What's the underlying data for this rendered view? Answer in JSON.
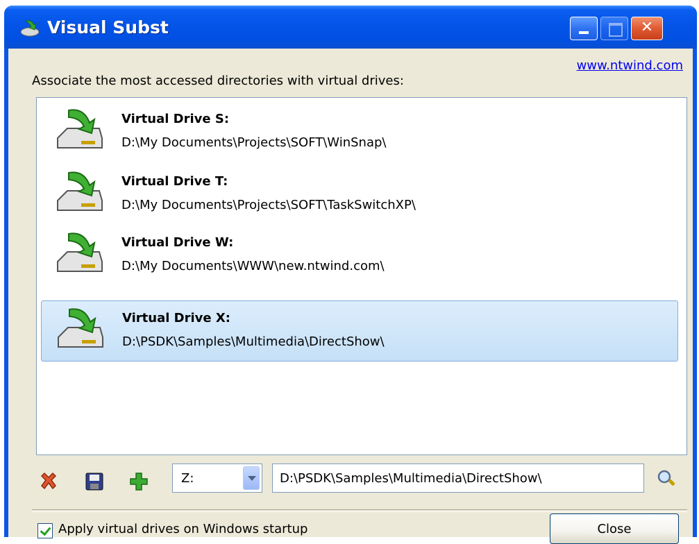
{
  "window": {
    "title": "Visual Subst",
    "close_glyph": "✕"
  },
  "header": {
    "link": "www.ntwind.com",
    "instruction": "Associate the most accessed directories with virtual drives:"
  },
  "drives": [
    {
      "name": "Virtual Drive S:",
      "path": "D:\\My Documents\\Projects\\SOFT\\WinSnap\\"
    },
    {
      "name": "Virtual Drive T:",
      "path": "D:\\My Documents\\Projects\\SOFT\\TaskSwitchXP\\"
    },
    {
      "name": "Virtual Drive W:",
      "path": "D:\\My Documents\\WWW\\new.ntwind.com\\"
    },
    {
      "name": "Virtual Drive X:",
      "path": "D:\\PSDK\\Samples\\Multimedia\\DirectShow\\",
      "selected": true
    }
  ],
  "toolbar": {
    "drive_letter": "Z:",
    "path_value": "D:\\PSDK\\Samples\\Multimedia\\DirectShow\\",
    "icons": [
      "delete-icon",
      "save-icon",
      "add-icon",
      "browse-icon"
    ]
  },
  "footer": {
    "startup_label": "Apply virtual drives on Windows startup",
    "startup_checked": true,
    "close_label": "Close"
  },
  "colors": {
    "titlebar": "#0454e8",
    "selection": "#c5e0f7",
    "face": "#ece9d8"
  }
}
